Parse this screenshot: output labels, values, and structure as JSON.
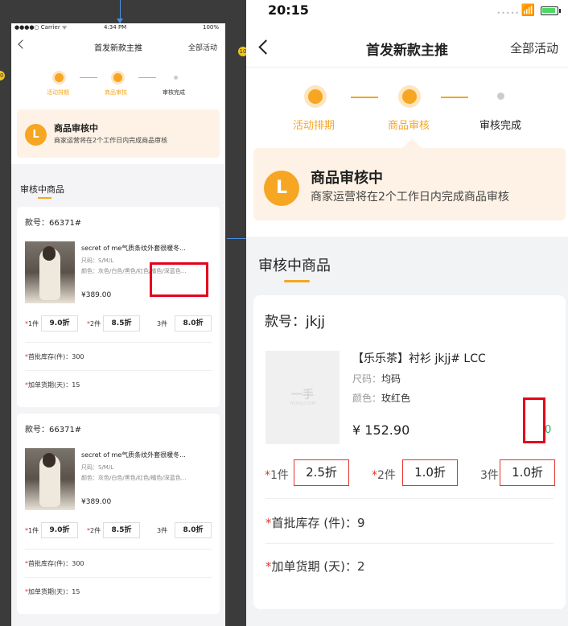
{
  "left": {
    "status": {
      "carrier": "●●●●○ Carrier ᯤ",
      "time": "4:34 PM",
      "battery": "100%"
    },
    "nav": {
      "title": "首发新款主推",
      "right": "全部活动"
    },
    "steps": [
      {
        "label": "活动排期",
        "state": "done"
      },
      {
        "label": "商品审核",
        "state": "active"
      },
      {
        "label": "审核完成",
        "state": "pending"
      }
    ],
    "banner": {
      "icon": "L",
      "title": "商品审核中",
      "subtitle": "商家运营将在2个工作日内完成商品审核"
    },
    "section_title": "审核中商品",
    "products": [
      {
        "code": "款号：66371#",
        "title": "secret of me气质条纹外套很暖冬...",
        "size": "尺码：S/M/L",
        "color": "颜色：灰色/白色/黑色/红色/橘色/深蓝色...",
        "price": "¥389.00",
        "discounts": [
          {
            "label": "1件",
            "starred": true,
            "value": "9.0折"
          },
          {
            "label": "2件",
            "starred": true,
            "value": "8.5折"
          },
          {
            "label": "3件",
            "starred": false,
            "value": "8.0折"
          }
        ],
        "stock": "首批库存(件)：300",
        "lead": "加单货期(天)：15"
      },
      {
        "code": "款号：66371#",
        "title": "secret of me气质条纹外套很暖冬...",
        "size": "尺码：S/M/L",
        "color": "颜色：灰色/白色/黑色/红色/橘色/深蓝色...",
        "price": "¥389.00",
        "discounts": [
          {
            "label": "1件",
            "starred": true,
            "value": "9.0折"
          },
          {
            "label": "2件",
            "starred": true,
            "value": "8.5折"
          },
          {
            "label": "3件",
            "starred": false,
            "value": "8.0折"
          }
        ],
        "stock": "首批库存(件)：300",
        "lead": "加单货期(天)：15"
      }
    ],
    "markers": [
      "10",
      "10"
    ]
  },
  "right": {
    "status": {
      "time": "20:15",
      "signal": "•••••"
    },
    "nav": {
      "title": "首发新款主推",
      "right": "全部活动"
    },
    "steps": [
      {
        "label": "活动排期",
        "state": "done"
      },
      {
        "label": "商品审核",
        "state": "active"
      },
      {
        "label": "审核完成",
        "state": "pending"
      }
    ],
    "banner": {
      "icon": "L",
      "title": "商品审核中",
      "subtitle": "商家运营将在2个工作日内完成商品审核"
    },
    "section_title": "审核中商品",
    "product": {
      "code": "款号：jkjj",
      "thumb_logo": "一手",
      "thumb_sub": "YISHOU.COM",
      "title": "【乐乐茶】衬衫  jkjj#  LCC",
      "size_label": "尺码：",
      "size_value": "均码",
      "color_label": "颜色：",
      "color_value": "玫红色",
      "price": "¥ 152.90",
      "badge": "0",
      "discounts": [
        {
          "label": "1件",
          "starred": true,
          "value": "2.5折"
        },
        {
          "label": "2件",
          "starred": true,
          "value": "1.0折"
        },
        {
          "label": "3件",
          "starred": false,
          "value": "1.0折"
        }
      ],
      "stock": "首批库存 (件)：9",
      "lead": "加单货期 (天)：2"
    }
  },
  "colors": {
    "accent": "#f6a623",
    "banner_bg": "#fdf2e5",
    "required": "#e5322d",
    "highlight": "#e5001c"
  }
}
